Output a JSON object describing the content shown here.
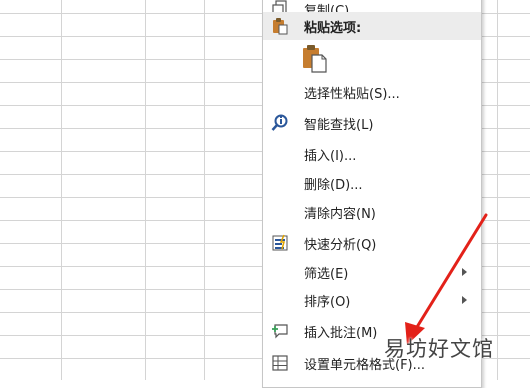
{
  "menu": {
    "copy": "复制(C)",
    "paste_header": "粘贴选项:",
    "paste_special": "选择性粘贴(S)...",
    "smart_lookup": "智能查找(L)",
    "insert": "插入(I)...",
    "delete": "删除(D)...",
    "clear": "清除内容(N)",
    "quick_analysis": "快速分析(Q)",
    "filter": "筛选(E)",
    "sort": "排序(O)",
    "insert_comment": "插入批注(M)",
    "format_cells": "设置单元格格式(F)..."
  },
  "watermark": "易坊好文馆",
  "colors": {
    "arrow": "#e32119",
    "grid": "#d4d4d4",
    "header_bg": "#ececec",
    "icon_blue": "#2b579a",
    "icon_orange": "#c67d2f"
  },
  "icons": [
    "copy-icon",
    "paste-clipboard-icon",
    "paste-options-icon",
    "smart-lookup-icon",
    "quick-analysis-icon",
    "insert-comment-icon",
    "format-cells-icon"
  ]
}
